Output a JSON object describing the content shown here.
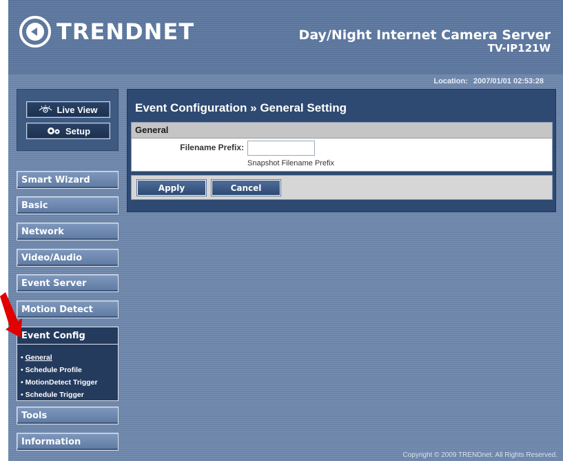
{
  "header": {
    "logo_text": "TRENDNET",
    "product_name": "Day/Night Internet Camera Server",
    "model": "TV-IP121W"
  },
  "status": {
    "location_label": "Location:",
    "datetime": "2007/01/01 02:53:28"
  },
  "view_buttons": {
    "live_view": "Live View",
    "setup": "Setup"
  },
  "menu": {
    "smart_wizard": "Smart Wizard",
    "basic": "Basic",
    "network": "Network",
    "video_audio": "Video/Audio",
    "event_server": "Event Server",
    "motion_detect": "Motion Detect",
    "event_config": "Event Config",
    "tools": "Tools",
    "information": "Information"
  },
  "submenu": [
    {
      "label": "General"
    },
    {
      "label": "Schedule Profile"
    },
    {
      "label": "MotionDetect Trigger"
    },
    {
      "label": "Schedule Trigger"
    }
  ],
  "page": {
    "title": "Event Configuration » General Setting",
    "section_title": "General",
    "filename_prefix_label": "Filename Prefix:",
    "filename_prefix_value": "",
    "filename_prefix_help": "Snapshot Filename Prefix",
    "apply_label": "Apply",
    "cancel_label": "Cancel"
  },
  "footer": {
    "copyright": "Copyright © 2009 TRENDnet. All Rights Reserved."
  },
  "colors": {
    "background": "#6f88ad",
    "panel": "#2e4a72",
    "active_menu": "#243b5e",
    "arrow": "#e00000"
  }
}
